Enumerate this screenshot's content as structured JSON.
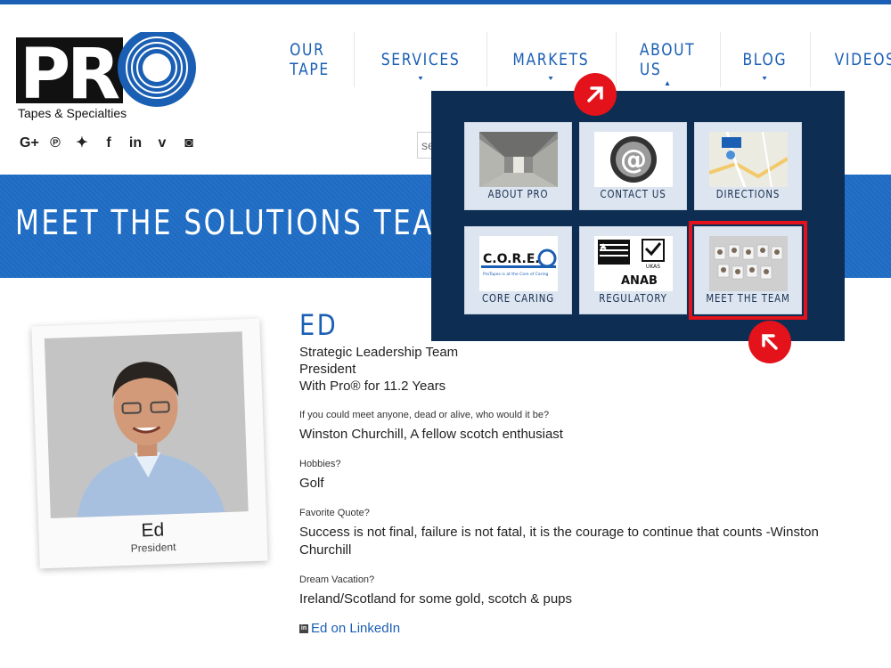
{
  "logo": {
    "text": "PRO",
    "tagline": "Tapes & Specialties"
  },
  "social": [
    "G+",
    "pinterest",
    "twitter",
    "facebook",
    "linkedin",
    "vimeo",
    "instagram"
  ],
  "nav": [
    {
      "label": "OUR TAPE"
    },
    {
      "label": "SERVICES"
    },
    {
      "label": "MARKETS"
    },
    {
      "label": "ABOUT US"
    },
    {
      "label": "BLOG"
    },
    {
      "label": "VIDEOS"
    }
  ],
  "search": {
    "placeholder": "search"
  },
  "banner": {
    "title": "MEET THE SOLUTIONS TEAM"
  },
  "dropdown": {
    "tiles": [
      {
        "label": "ABOUT PRO"
      },
      {
        "label": "CONTACT US"
      },
      {
        "label": "DIRECTIONS"
      },
      {
        "label": "CORE CARING"
      },
      {
        "label": "REGULATORY"
      },
      {
        "label": "MEET THE TEAM"
      }
    ],
    "core_logo": "C.O.R.E.",
    "core_sub": "ProTapes is at the Core of Caring",
    "reg_text": "ANAB",
    "reg_sub": "UKAS"
  },
  "profile": {
    "name": "ED",
    "card_name": "Ed",
    "card_role": "President",
    "team": "Strategic Leadership Team",
    "title": "President",
    "tenure": "With Pro® for 11.2 Years",
    "qa": [
      {
        "q": "If you could meet anyone, dead or alive, who would it be?",
        "a": "Winston Churchill, A fellow scotch enthusiast"
      },
      {
        "q": "Hobbies?",
        "a": "Golf"
      },
      {
        "q": "Favorite Quote?",
        "a": "Success is not final, failure is not fatal, it is the courage to continue that counts -Winston Churchill"
      },
      {
        "q": "Dream Vacation?",
        "a": "Ireland/Scotland for some gold, scotch & pups"
      }
    ],
    "linkedin": "Ed on LinkedIn"
  },
  "colors": {
    "brand_blue": "#1a5fb4",
    "dropdown_bg": "#0e2d52",
    "highlight_red": "#e3121b"
  }
}
